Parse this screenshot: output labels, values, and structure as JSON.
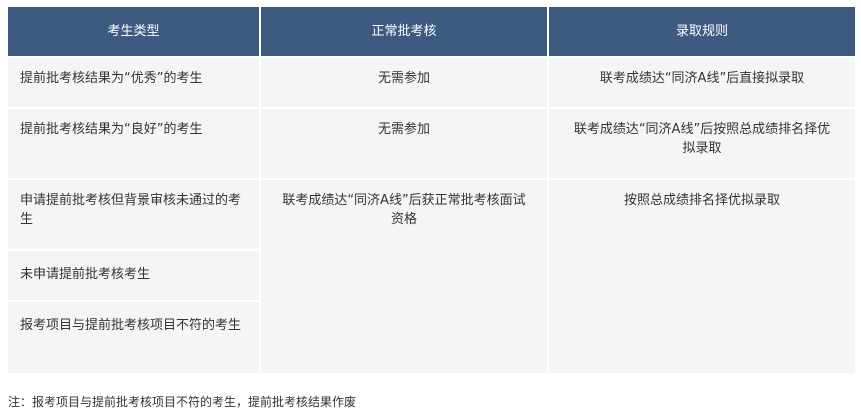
{
  "table": {
    "headers": [
      "考生类型",
      "正常批考核",
      "录取规则"
    ],
    "rows": [
      {
        "type": "提前批考核结果为“优秀”的考生",
        "normal": "无需参加",
        "rule": "联考成绩达“同济A线”后直接拟录取"
      },
      {
        "type": "提前批考核结果为“良好”的考生",
        "normal": "无需参加",
        "rule": "联考成绩达“同济A线”后按照总成绩排名择优拟录取"
      },
      {
        "type": "申请提前批考核但背景审核未通过的考生"
      },
      {
        "type": "未申请提前批考核考生"
      },
      {
        "type": "报考项目与提前批考核项目不符的考生"
      }
    ],
    "merged": {
      "normal": "联考成绩达“同济A线”后获正常批考核面试资格",
      "rule": "按照总成绩排名择优拟录取"
    }
  },
  "note": "注：报考项目与提前批考核项目不符的考生，提前批考核结果作废"
}
